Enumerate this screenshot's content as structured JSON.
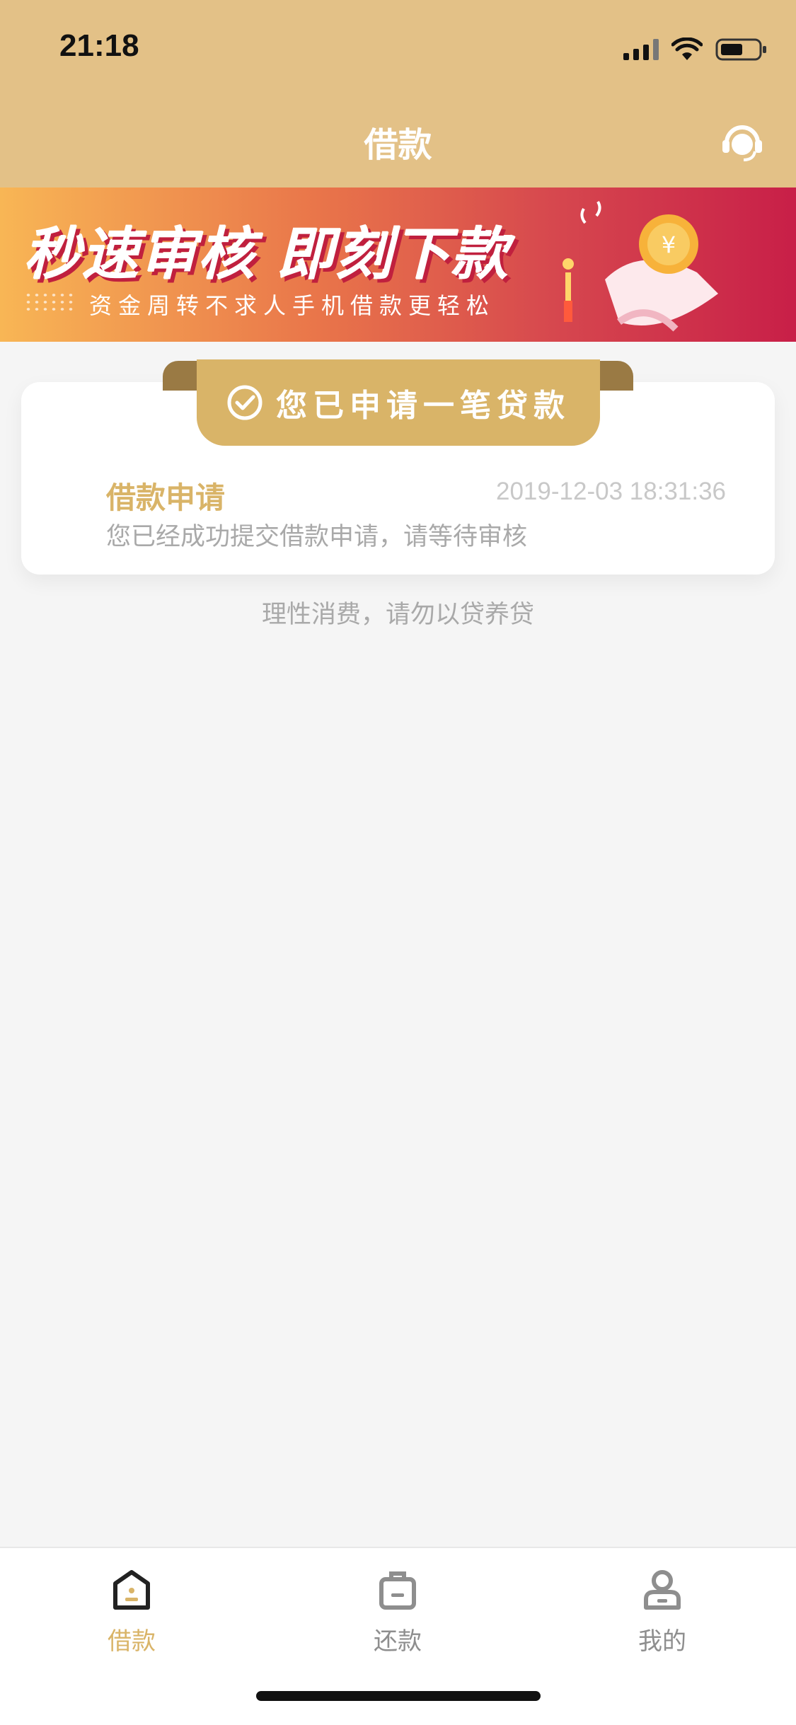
{
  "status_bar": {
    "time": "21:18"
  },
  "header": {
    "title": "借款"
  },
  "banner": {
    "headline": "秒速审核  即刻下款",
    "subline": "资金周转不求人手机借款更轻松"
  },
  "application_card": {
    "ribbon_text": "您已申请一笔贷款",
    "record": {
      "title": "借款申请",
      "time": "2019-12-03 18:31:36",
      "description": "您已经成功提交借款申请，请等待审核"
    }
  },
  "notice": "理性消费，请勿以贷养贷",
  "tabbar": {
    "items": [
      {
        "label": "借款",
        "icon": "loan-icon",
        "active": true
      },
      {
        "label": "还款",
        "icon": "repay-icon",
        "active": false
      },
      {
        "label": "我的",
        "icon": "profile-icon",
        "active": false
      }
    ]
  },
  "colors": {
    "header_bg": "#e3c187",
    "accent_gold": "#d9b468",
    "tab_inactive": "#8e8e8e"
  }
}
